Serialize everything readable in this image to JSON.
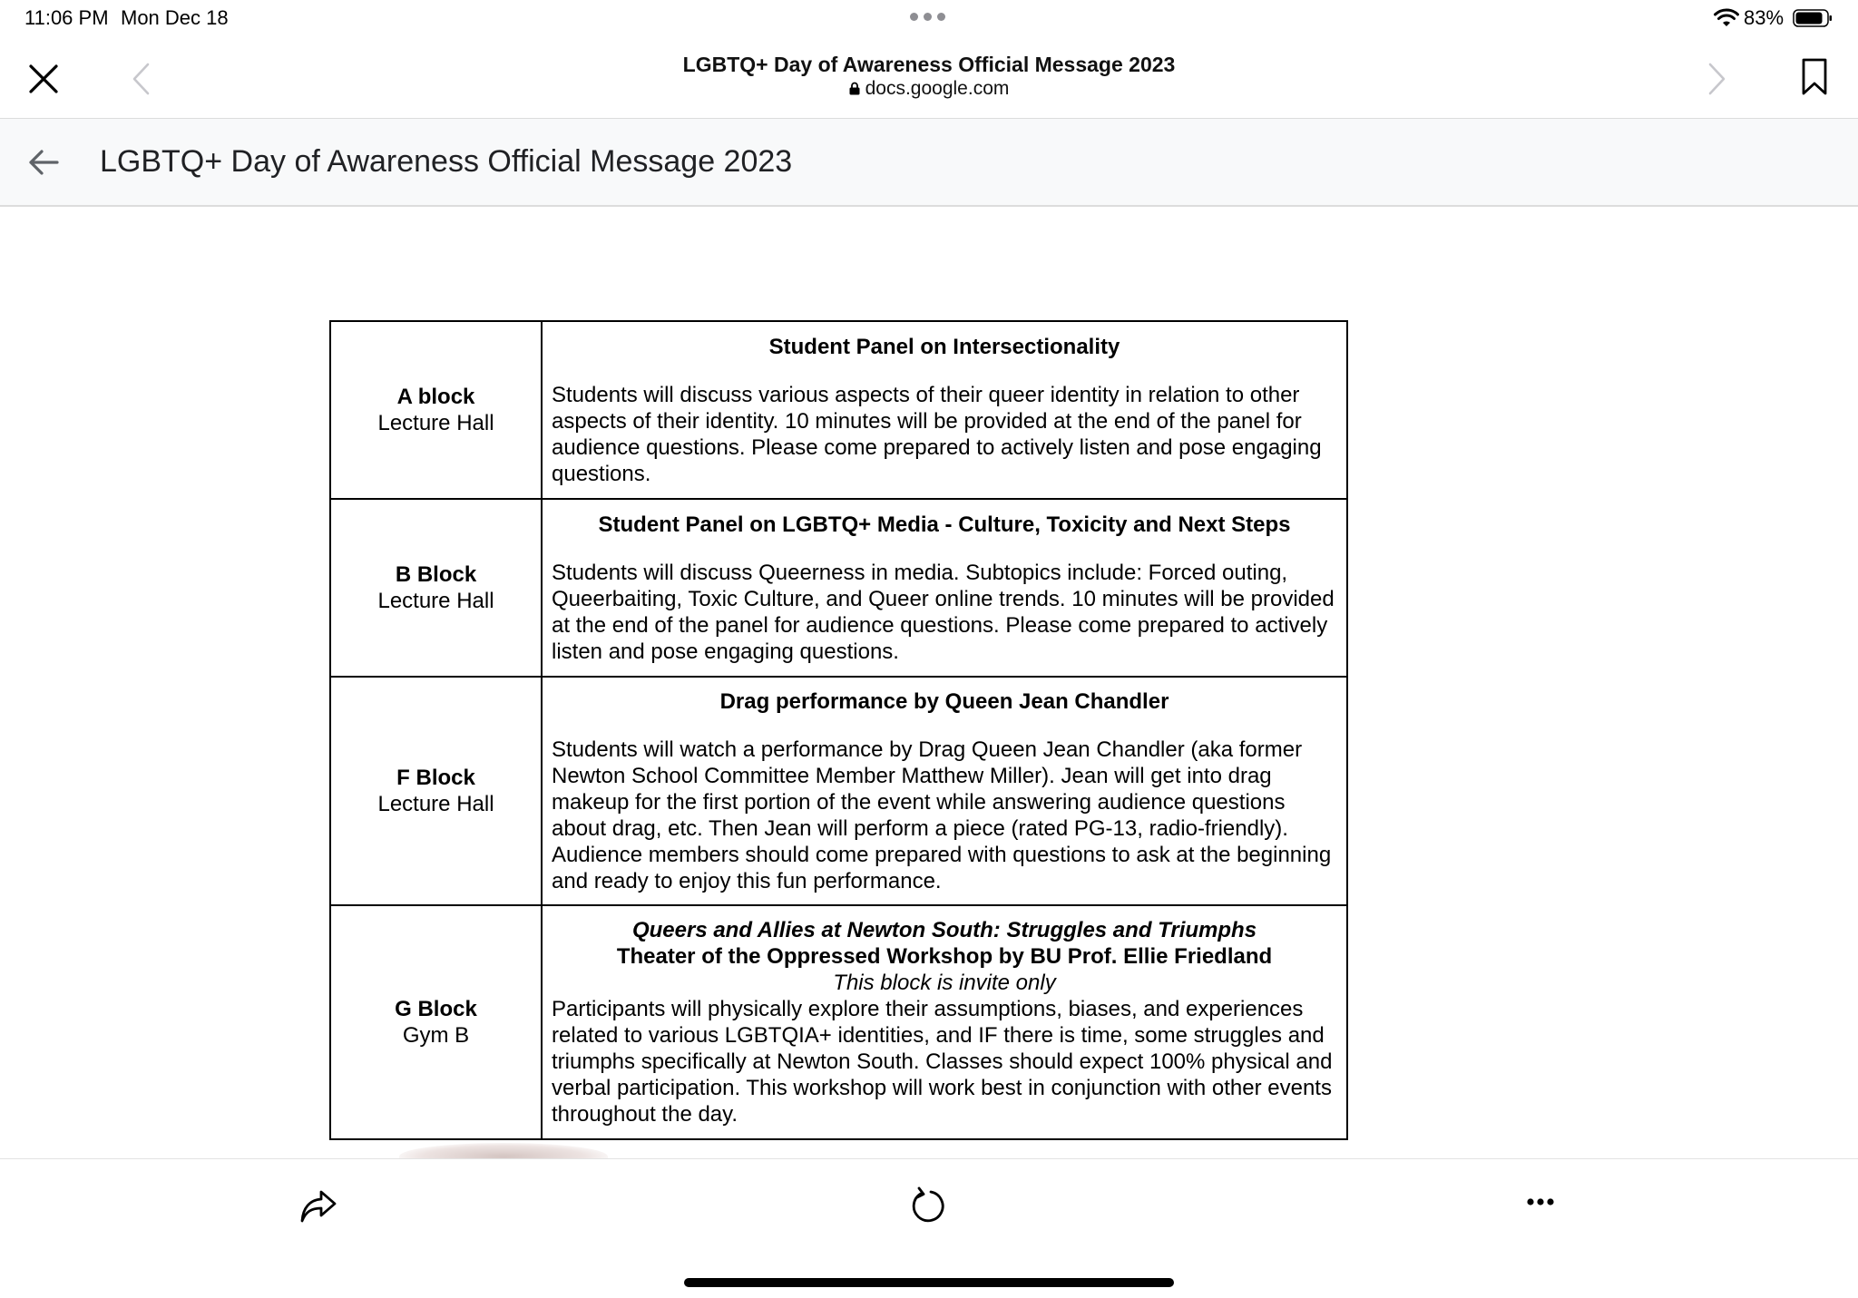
{
  "status_bar": {
    "time": "11:06 PM",
    "date": "Mon Dec 18",
    "battery": "83%"
  },
  "browser": {
    "title": "LGBTQ+ Day of Awareness Official Message 2023",
    "url": "docs.google.com"
  },
  "doc_header": {
    "title": "LGBTQ+ Day of Awareness Official Message 2023"
  },
  "schedule": {
    "rows": [
      {
        "block": "A block",
        "room": "Lecture Hall",
        "title": "Student Panel on Intersectionality",
        "description": "Students will discuss various aspects of their queer identity in relation to other aspects of their identity. 10 minutes will be provided at the end of the panel for audience questions. Please come prepared to actively listen and pose engaging questions."
      },
      {
        "block": "B Block",
        "room": "Lecture Hall",
        "title": "Student Panel on LGBTQ+ Media - Culture, Toxicity and Next Steps",
        "description": "Students will discuss Queerness in media. Subtopics include: Forced outing, Queerbaiting, Toxic Culture, and Queer online trends. 10 minutes will be provided at the end of the panel for audience questions. Please come prepared to actively listen and pose engaging questions."
      },
      {
        "block": "F Block",
        "room": "Lecture Hall",
        "title": "Drag performance by Queen Jean Chandler",
        "description": "Students will watch a performance by Drag Queen Jean Chandler (aka former Newton School Committee Member Matthew Miller). Jean will get into drag makeup for the first portion of the event while answering audience questions about drag, etc. Then Jean will perform a piece (rated PG-13, radio-friendly). Audience members should come prepared with questions to ask at the beginning and ready to enjoy this fun performance."
      },
      {
        "block": "G Block",
        "room": "Gym B",
        "title": "Queers and Allies at Newton South: Struggles and Triumphs",
        "subtitle": "Theater of the Oppressed Workshop by BU Prof. Ellie Friedland",
        "note": "This block is invite only",
        "description": "Participants will physically explore their assumptions, biases, and experiences related to various LGBTQIA+ identities, and IF there is time, some struggles and triumphs specifically at Newton South. Classes should expect 100% physical and verbal participation. This workshop will work best in conjunction with other events throughout the day."
      }
    ]
  },
  "icons": {
    "close": "close-icon",
    "back": "chevron-left-icon",
    "forward": "chevron-right-icon",
    "bookmark": "bookmark-icon",
    "doc_back": "arrow-back-icon",
    "share": "share-icon",
    "reload": "reload-icon",
    "more": "more-icon"
  }
}
